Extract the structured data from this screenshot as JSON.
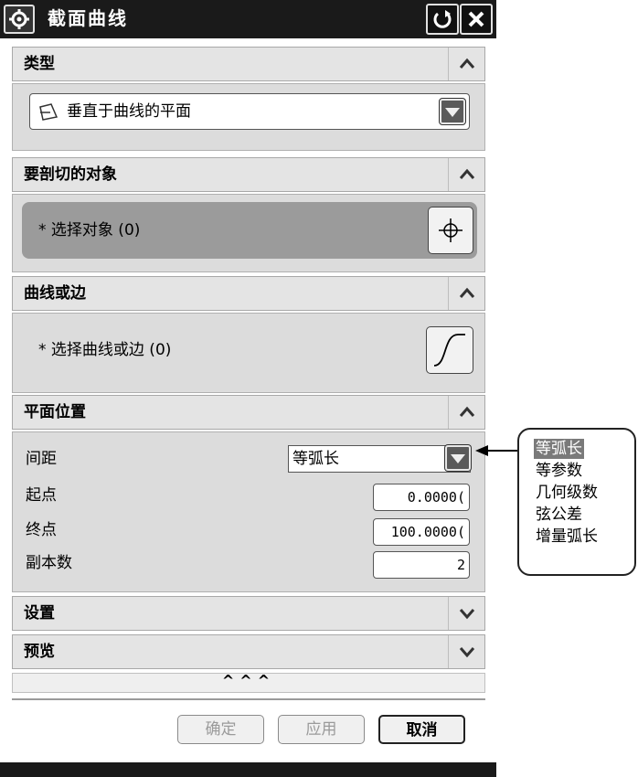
{
  "dialog": {
    "title": "截面曲线"
  },
  "sections": {
    "type": {
      "header": "类型",
      "selected_value": "垂直于曲线的平面"
    },
    "objects": {
      "header": "要剖切的对象",
      "select_label": "* 选择对象 (0)"
    },
    "curves": {
      "header": "曲线或边",
      "select_label": "* 选择曲线或边 (0)"
    },
    "plane_location": {
      "header": "平面位置",
      "spacing_label": "间距",
      "spacing_value": "等弧长",
      "start_label": "起点",
      "start_value": "0.0000(",
      "end_label": "终点",
      "end_value": "100.0000(",
      "copies_label": "副本数",
      "copies_value": "2"
    },
    "settings": {
      "header": "设置"
    },
    "preview": {
      "header": "预览"
    }
  },
  "footer": {
    "more_arrows": "^^^"
  },
  "buttons": {
    "ok": "确定",
    "apply": "应用",
    "cancel": "取消"
  },
  "spacing_options": [
    {
      "label": "等弧长",
      "selected": true
    },
    {
      "label": "等参数",
      "selected": false
    },
    {
      "label": "几何级数",
      "selected": false
    },
    {
      "label": "弦公差",
      "selected": false
    },
    {
      "label": "增量弧长",
      "selected": false
    }
  ],
  "icons": {
    "title": "gear-icon",
    "reset": "reset-icon",
    "close": "close-icon",
    "collapse": "chevron-up-icon",
    "expand": "chevron-down-icon",
    "plane": "plane-icon",
    "select_object": "crosshair-icon",
    "select_curve": "curve-icon"
  },
  "colors": {
    "titlebar": "#1a1a1a",
    "section_header": "#e4e4e4",
    "section_body": "#dcdcdc",
    "selection_row": "#9b9b9b",
    "selected_option": "#7a7a7a"
  }
}
